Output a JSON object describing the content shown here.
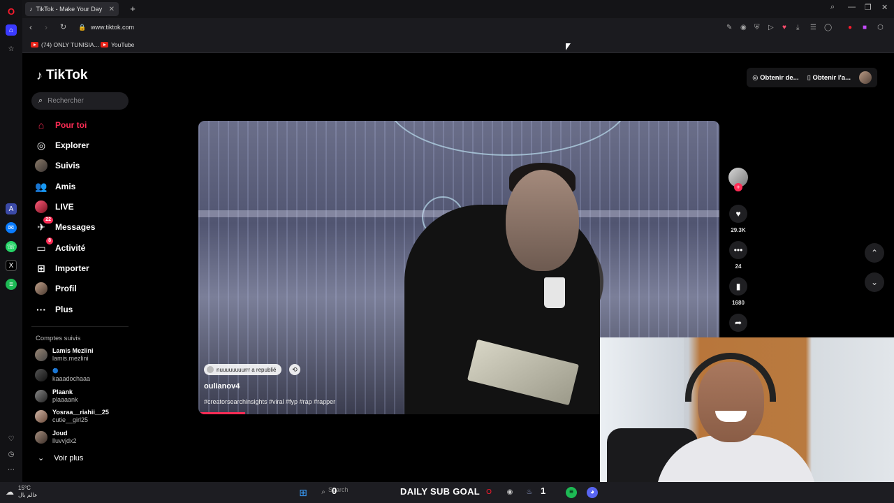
{
  "browser": {
    "tab_title": "TikTok - Make Your Day",
    "url": "www.tiktok.com",
    "bookmarks": [
      {
        "label": "(74) ONLY TUNISIA..."
      },
      {
        "label": "YouTube"
      }
    ]
  },
  "tiktok": {
    "logo": "TikTok",
    "search_placeholder": "Rechercher",
    "nav": [
      {
        "label": "Pour toi",
        "icon": "home-icon"
      },
      {
        "label": "Explorer",
        "icon": "compass-icon"
      },
      {
        "label": "Suivis",
        "icon": "avatar"
      },
      {
        "label": "Amis",
        "icon": "friends-icon"
      },
      {
        "label": "LIVE",
        "icon": "live-icon"
      },
      {
        "label": "Messages",
        "icon": "message-icon",
        "badge": "22"
      },
      {
        "label": "Activité",
        "icon": "activity-icon",
        "badge": "8"
      },
      {
        "label": "Importer",
        "icon": "upload-icon"
      },
      {
        "label": "Profil",
        "icon": "avatar"
      },
      {
        "label": "Plus",
        "icon": "more-icon"
      }
    ],
    "following_title": "Comptes suivis",
    "following": [
      {
        "name": "Lamis Mezlini",
        "handle": "lamis.mezlini"
      },
      {
        "name": "🔵",
        "handle": "kaaadochaaa"
      },
      {
        "name": "Plaank",
        "handle": "plaaaank"
      },
      {
        "name": "Yosraa__riahii__25",
        "handle": "cutie__girl25"
      },
      {
        "name": "Joud",
        "handle": "lluvvjdx2"
      }
    ],
    "see_more": "Voir plus",
    "top_buttons": {
      "coins": "Obtenir de...",
      "app": "Obtenir l'a..."
    },
    "video": {
      "repost_text": "nuuuuuuuurrr a republié",
      "author": "oulianov4",
      "tags": "#creatorsearchinsights #viral #fyp #rap #rapper",
      "progress": 0.09,
      "likes": "29.3K",
      "comments": "24",
      "saves": "1680"
    }
  },
  "taskbar": {
    "temperature": "15°C",
    "location": "عالم بال",
    "search_placeholder": "Search",
    "goal_left": "0",
    "goal_title": "DAILY SUB GOAL",
    "goal_right": "1"
  }
}
